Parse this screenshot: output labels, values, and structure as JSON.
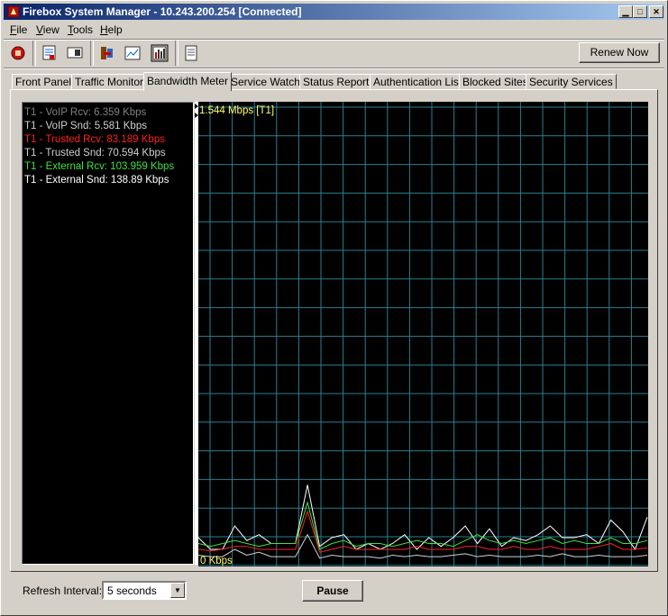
{
  "window": {
    "title": "Firebox System Manager - 10.243.200.254 [Connected]",
    "controls": [
      "minimize",
      "maximize",
      "close"
    ]
  },
  "menu": [
    {
      "label": "File",
      "mnemonic": "F",
      "rest": "ile"
    },
    {
      "label": "View",
      "mnemonic": "V",
      "rest": "iew"
    },
    {
      "label": "Tools",
      "mnemonic": "T",
      "rest": "ools"
    },
    {
      "label": "Help",
      "mnemonic": "H",
      "rest": "elp"
    }
  ],
  "toolbar": {
    "icons": [
      "stop-icon",
      "report-icon",
      "screen-icon",
      "tools-icon",
      "chart-window-icon",
      "bandwidth-icon",
      "document-icon"
    ],
    "renew_label": "Renew Now"
  },
  "tabs": [
    {
      "label": "Front Panel",
      "active": false
    },
    {
      "label": "Traffic Monitor",
      "active": false
    },
    {
      "label": "Bandwidth Meter",
      "active": true
    },
    {
      "label": "Service Watch",
      "active": false
    },
    {
      "label": "Status Report",
      "active": false
    },
    {
      "label": "Authentication List",
      "active": false
    },
    {
      "label": "Blocked Sites",
      "active": false
    },
    {
      "label": "Security Services",
      "active": false
    }
  ],
  "legend": [
    {
      "text": "T1 - VoIP Rcv: 6.359 Kbps",
      "color": "#808080"
    },
    {
      "text": "T1 - VoIP Snd: 5.581 Kbps",
      "color": "#d0d0d0"
    },
    {
      "text": "T1 - Trusted Rcv: 83.189 Kbps",
      "color": "#ff2020"
    },
    {
      "text": "T1 - Trusted Snd: 70.594 Kbps",
      "color": "#d0d0d0"
    },
    {
      "text": "T1 - External Rcv: 103.959 Kbps",
      "color": "#40e040"
    },
    {
      "text": "T1 - External Snd: 138.89 Kbps",
      "color": "#ffffff"
    }
  ],
  "graph": {
    "max_label": "1.544 Mbps [T1]",
    "min_label": "0 Kbps",
    "grid_color": "#2a7f8f"
  },
  "chart_data": {
    "type": "line",
    "ylim": [
      0,
      1544
    ],
    "unit": "Kbps",
    "series": [
      {
        "color": "#ffffff",
        "values": [
          80,
          40,
          40,
          120,
          70,
          90,
          60,
          60,
          60,
          260,
          50,
          80,
          90,
          40,
          60,
          40,
          60,
          90,
          40,
          80,
          50,
          80,
          120,
          60,
          110,
          50,
          80,
          70,
          90,
          120,
          80,
          80,
          90,
          60,
          140,
          100,
          40,
          150
        ]
      },
      {
        "color": "#40e040",
        "values": [
          60,
          50,
          60,
          70,
          60,
          50,
          60,
          60,
          60,
          200,
          40,
          60,
          70,
          50,
          60,
          60,
          50,
          60,
          70,
          60,
          60,
          50,
          70,
          90,
          70,
          60,
          70,
          60,
          70,
          80,
          60,
          70,
          60,
          60,
          80,
          60,
          60,
          70
        ]
      },
      {
        "color": "#ff2020",
        "values": [
          40,
          35,
          40,
          50,
          50,
          40,
          40,
          40,
          40,
          170,
          30,
          40,
          50,
          40,
          40,
          40,
          40,
          40,
          50,
          40,
          40,
          40,
          50,
          50,
          40,
          40,
          50,
          40,
          40,
          50,
          40,
          40,
          40,
          50,
          60,
          40,
          40,
          45
        ]
      },
      {
        "color": "#d0d0d0",
        "values": [
          20,
          15,
          15,
          40,
          20,
          30,
          15,
          15,
          15,
          90,
          10,
          20,
          15,
          15,
          15,
          10,
          20,
          15,
          20,
          15,
          15,
          20,
          25,
          15,
          20,
          15,
          15,
          15,
          20,
          15,
          25,
          15,
          15,
          20,
          15,
          15,
          15,
          20
        ]
      }
    ]
  },
  "footer": {
    "refresh_label": "Refresh Interval:",
    "refresh_value": "5 seconds",
    "pause_label": "Pause"
  }
}
